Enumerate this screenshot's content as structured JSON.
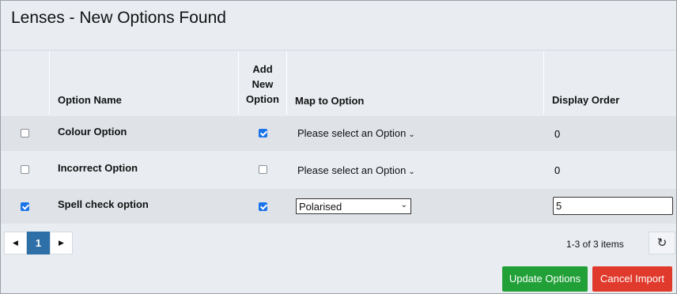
{
  "title": "Lenses - New Options Found",
  "columns": {
    "select": "",
    "option_name": "Option Name",
    "add_new_line1": "Add",
    "add_new_line2": "New",
    "add_new_line3": "Option",
    "map_to": "Map to Option",
    "display_order": "Display Order"
  },
  "rows": [
    {
      "selected": false,
      "name": "Colour Option",
      "add_new": true,
      "map_to": "Please select an Option",
      "display_order": "0",
      "editing": false
    },
    {
      "selected": false,
      "name": "Incorrect Option",
      "add_new": false,
      "map_to": "Please select an Option",
      "display_order": "0",
      "editing": false
    },
    {
      "selected": true,
      "name": "Spell check option",
      "add_new": true,
      "map_to": "Polarised",
      "display_order": "5",
      "editing": true
    }
  ],
  "pager": {
    "prev_icon": "◀",
    "page": "1",
    "next_icon": "▶",
    "summary": "1-3 of 3 items",
    "refresh_icon": "↻"
  },
  "buttons": {
    "update": "Update Options",
    "cancel": "Cancel Import"
  },
  "colors": {
    "green": "#21a038",
    "red": "#e03a2c",
    "accent": "#2f6fa8"
  }
}
